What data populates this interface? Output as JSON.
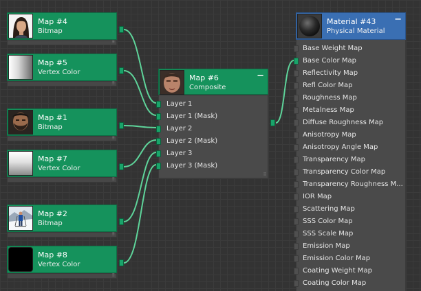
{
  "map_nodes": [
    {
      "id": "map4",
      "title": "Map #4",
      "subtitle": "Bitmap",
      "thumb": "portrait-woman"
    },
    {
      "id": "map5",
      "title": "Map #5",
      "subtitle": "Vertex Color",
      "thumb": "gradient-white-gray"
    },
    {
      "id": "map1",
      "title": "Map #1",
      "subtitle": "Bitmap",
      "thumb": "portrait-bearded-man"
    },
    {
      "id": "map7",
      "title": "Map #7",
      "subtitle": "Vertex Color",
      "thumb": "gradient-white-gray-vertical"
    },
    {
      "id": "map2",
      "title": "Map #2",
      "subtitle": "Bitmap",
      "thumb": "skier-on-snow"
    },
    {
      "id": "map8",
      "title": "Map #8",
      "subtitle": "Vertex Color",
      "thumb": "solid-black"
    }
  ],
  "composite": {
    "title": "Map #6",
    "subtitle": "Composite",
    "collapse_label": "−",
    "thumb": "portrait-man",
    "layers": [
      "Layer 1",
      "Layer 1 (Mask)",
      "Layer 2",
      "Layer 2 (Mask)",
      "Layer 3",
      "Layer 3 (Mask)"
    ]
  },
  "material": {
    "title": "Material #43",
    "subtitle": "Physical Material",
    "collapse_label": "−",
    "thumb": "dark-sphere",
    "slots": [
      "Base Weight Map",
      "Base Color Map",
      "Reflectivity Map",
      "Refl Color Map",
      "Roughness Map",
      "Metalness Map",
      "Diffuse Roughness Map",
      "Anisotropy Map",
      "Anisotropy Angle Map",
      "Transparency Map",
      "Transparency Color Map",
      "Transparency Roughness M...",
      "IOR Map",
      "Scattering Map",
      "SSS Color Map",
      "SSS Scale Map",
      "Emission Map",
      "Emission Color Map",
      "Coating Weight Map",
      "Coating Color Map"
    ],
    "connected_slot": "Base Color Map"
  },
  "colors": {
    "map_header": "#15925c",
    "material_header": "#3a6fb3",
    "wire": "#5ed49a",
    "background": "#333333"
  }
}
